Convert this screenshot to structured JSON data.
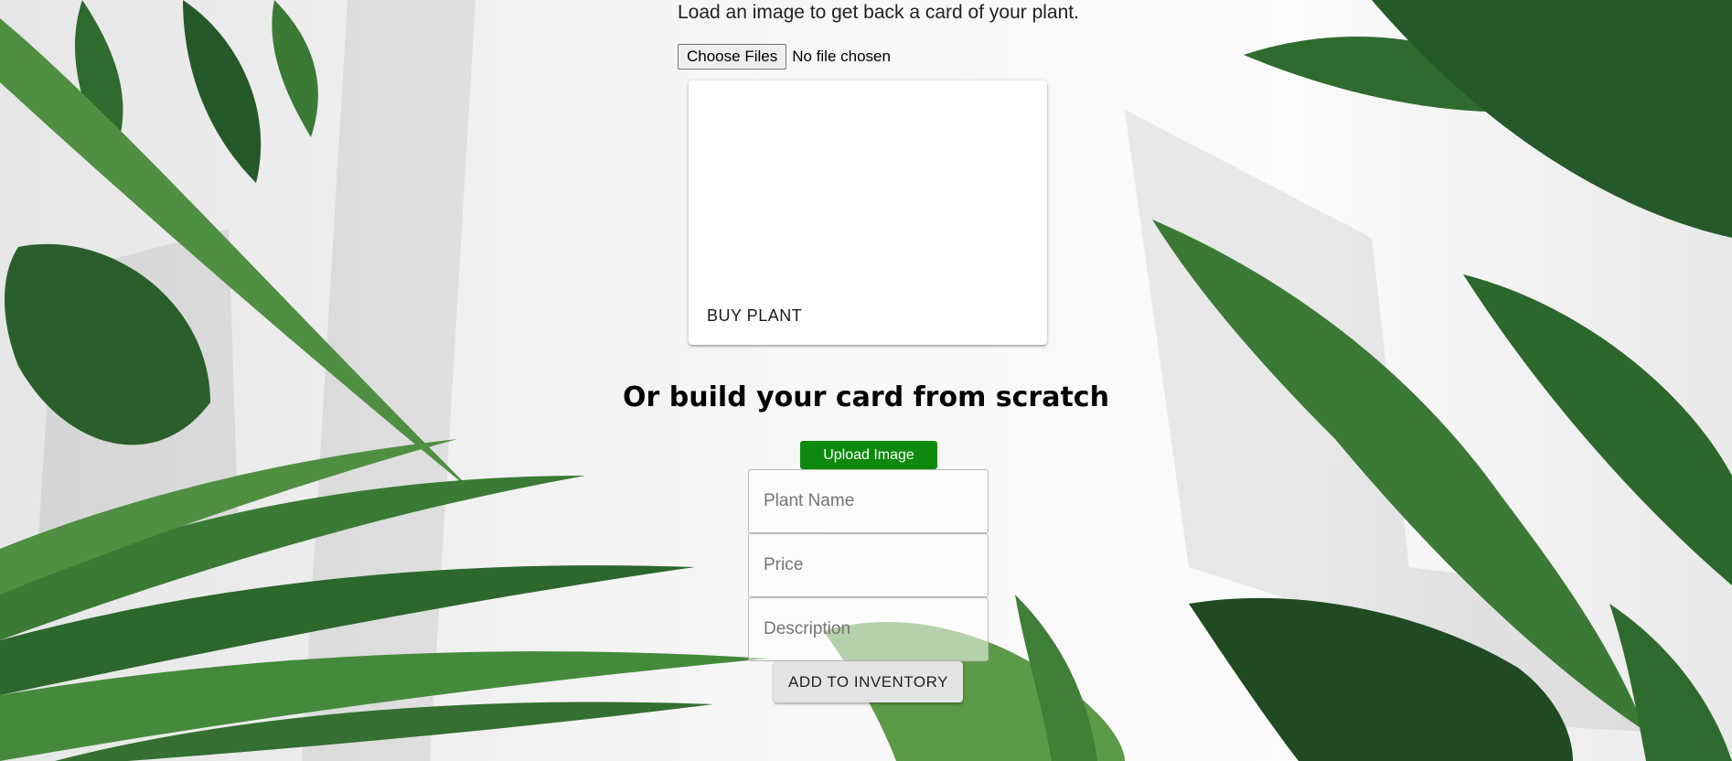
{
  "intro_text": "Load an image to get back a card of your plant.",
  "file_input": {
    "button_label": "Choose Files",
    "status": "No file chosen"
  },
  "card": {
    "action_label": "BUY PLANT"
  },
  "builder": {
    "heading": "Or build your card from scratch",
    "upload_label": "Upload Image",
    "fields": {
      "name_placeholder": "Plant Name",
      "price_placeholder": "Price",
      "description_placeholder": "Description"
    },
    "submit_label": "ADD TO INVENTORY"
  },
  "colors": {
    "upload_button": "#0d8a0d",
    "leaf_dark": "#1f4a22",
    "leaf_mid": "#2f6b2e",
    "leaf_light": "#4f8f42"
  }
}
